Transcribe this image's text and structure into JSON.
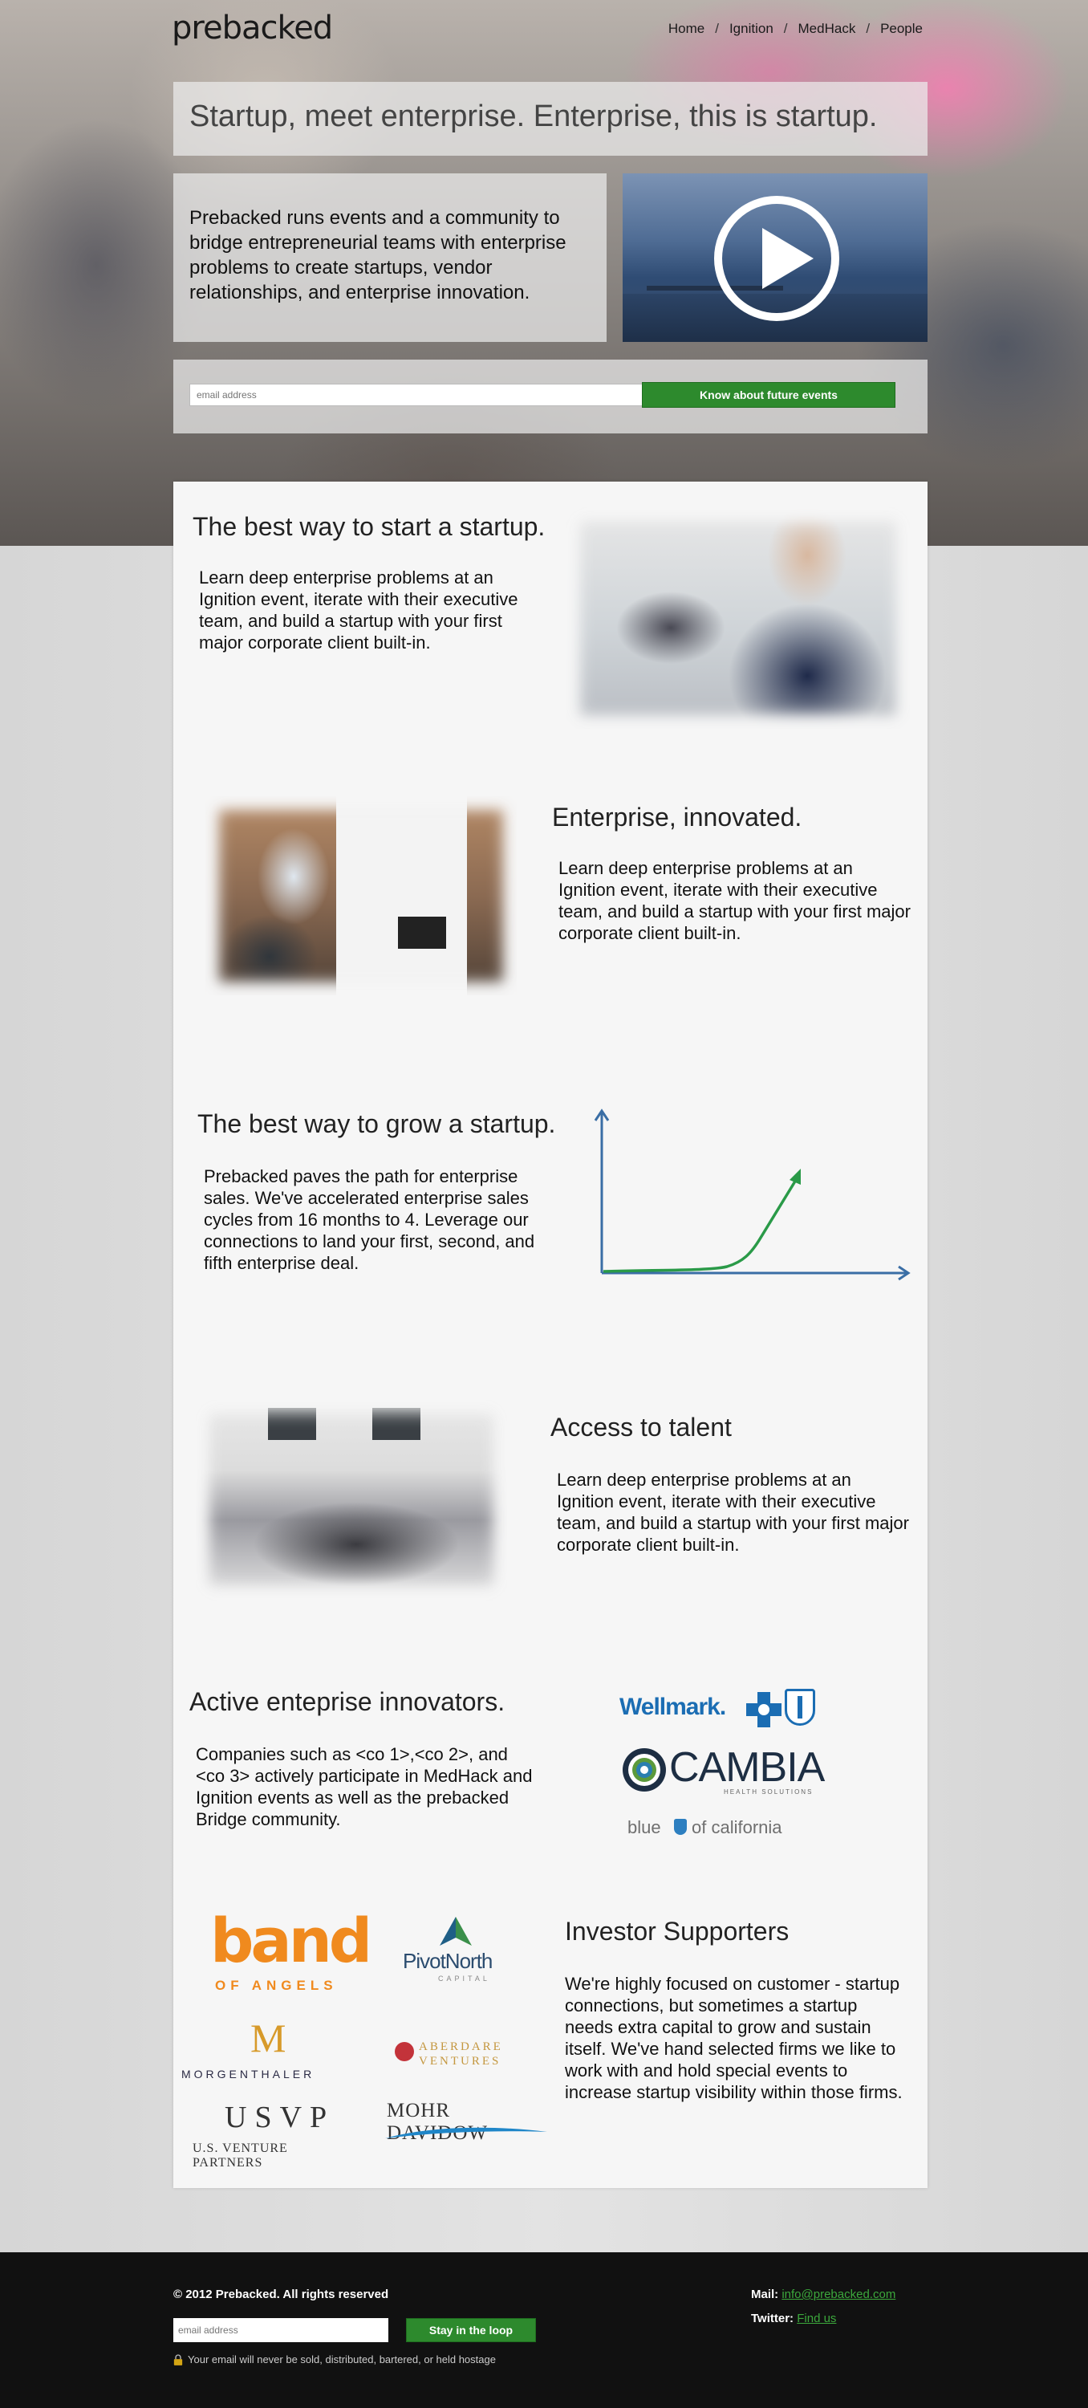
{
  "header": {
    "logo": "prebacked",
    "nav": [
      "Home",
      "Ignition",
      "MedHack",
      "People"
    ],
    "nav_sep": "/"
  },
  "hero": {
    "headline": "Startup, meet enterprise. Enterprise, this is startup.",
    "intro": "Prebacked runs events and a community to bridge entrepreneurial teams with enterprise problems to create startups, vendor relationships, and enterprise innovation.",
    "email_placeholder": "email address",
    "signup_button": "Know about future events"
  },
  "sections": {
    "start": {
      "title": "The best way to start a startup.",
      "text": "Learn deep enterprise problems at an Ignition event, iterate with their executive team, and build a startup with your first major corporate client built-in."
    },
    "innovated": {
      "title": "Enterprise, innovated.",
      "text": "Learn deep enterprise problems at an Ignition event, iterate with their executive team, and build a startup with your first major corporate client built-in."
    },
    "grow": {
      "title": "The best way to grow a startup.",
      "text": "Prebacked paves the path for enterprise sales.  We've accelerated enterprise sales cycles from 16 months to 4.  Leverage our connections to land your first, second, and fifth enterprise deal."
    },
    "talent": {
      "title": "Access to talent",
      "text": "Learn deep enterprise problems at an Ignition event, iterate with their executive team, and build a startup with your first major corporate client built-in."
    },
    "innovators": {
      "title": "Active enteprise innovators.",
      "text": "Companies such as <co 1>,<co 2>, and <co 3> actively participate in MedHack and Ignition events as well as the prebacked Bridge community.",
      "logos": {
        "wellmark": "Wellmark.",
        "cambia": "CAMBIA",
        "cambia_sub": "HEALTH SOLUTIONS",
        "blue_shield_pre": "blue",
        "blue_shield_post": "of california"
      }
    },
    "investors": {
      "title": "Investor Supporters",
      "text": "We're highly focused on customer - startup connections, but sometimes a startup needs extra capital to grow and sustain itself.  We've hand selected firms we like to work with and hold special events to increase startup visibility within those firms.",
      "logos": {
        "band": "band",
        "band_sub": "OF ANGELS",
        "pivot": "PivotNorth",
        "pivot_sub": "CAPITAL",
        "morgen_mark": "M",
        "morgen": "MORGENTHALER",
        "aberdare": "ABERDARE",
        "aberdare_sub": "VENTURES",
        "usvp": "USVP",
        "usvp_sub": "U.S. VENTURE PARTNERS",
        "mohr": "MOHR DAVIDOW"
      }
    }
  },
  "footer": {
    "copyright": "© 2012 Prebacked. All rights reserved",
    "email_placeholder": "email address",
    "button": "Stay in the loop",
    "note": "Your email will never be sold, distributed, bartered, or held hostage",
    "mail_label": "Mail:",
    "mail_value": "info@prebacked.com",
    "twitter_label": "Twitter:",
    "twitter_value": "Find us"
  },
  "colors": {
    "accent_green": "#2d8a2d",
    "chart_axis": "#3a6ea5",
    "chart_line": "#2a9a48"
  }
}
